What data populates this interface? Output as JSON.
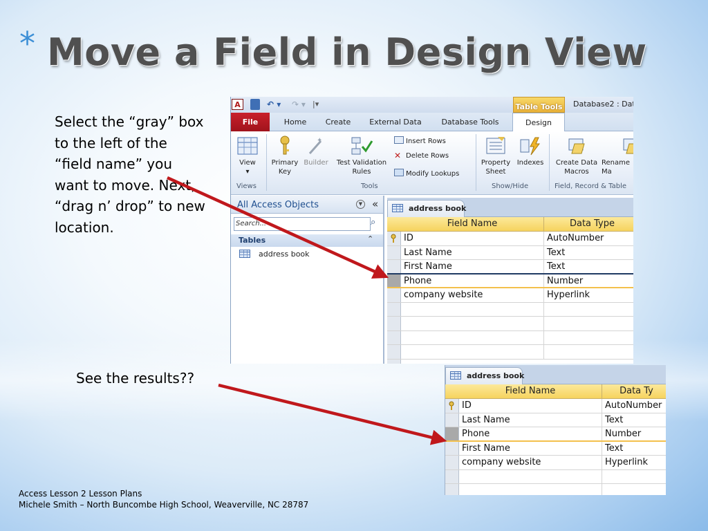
{
  "slide": {
    "title_bullet": "*",
    "title": "Move a Field in Design View",
    "instructions": "Select the “gray” box to the left of the “field name” you want to move.  Next, “drag n’ drop” to new location.",
    "results_caption": "See the results??",
    "footer_line1": "Access Lesson 2 Lesson Plans",
    "footer_line2": "Michele Smith – North Buncombe High School, Weaverville, NC  28787",
    "arrow_color": "#c0181c"
  },
  "access": {
    "app_icon": "A",
    "context_tab": "Table Tools",
    "window_title": "Database2 : Dat",
    "tabs": [
      "File",
      "Home",
      "Create",
      "External Data",
      "Database Tools",
      "Design"
    ],
    "ribbon": {
      "view": "View",
      "primary_key": "Primary Key",
      "builder": "Builder",
      "test_validation": "Test Validation Rules",
      "insert_rows": "Insert Rows",
      "delete_rows": "Delete Rows",
      "modify_lookups": "Modify Lookups",
      "property_sheet": "Property Sheet",
      "indexes": "Indexes",
      "create_data_macros": "Create Data Macros",
      "rename": "Rename Ma",
      "group_views": "Views",
      "group_tools": "Tools",
      "group_showhide": "Show/Hide",
      "group_field": "Field, Record & Table"
    },
    "nav": {
      "title": "All Access Objects",
      "search_placeholder": "Search...",
      "group": "Tables",
      "item": "address book"
    }
  },
  "designer_before": {
    "tab": "address book",
    "col_field": "Field Name",
    "col_type": "Data Type",
    "rows": [
      {
        "field": "ID",
        "type": "AutoNumber"
      },
      {
        "field": "Last Name",
        "type": "Text"
      },
      {
        "field": "First Name",
        "type": "Text"
      },
      {
        "field": "Phone",
        "type": "Number"
      },
      {
        "field": "company website",
        "type": "Hyperlink"
      }
    ]
  },
  "designer_after": {
    "tab": "address book",
    "col_field": "Field Name",
    "col_type": "Data Ty",
    "rows": [
      {
        "field": "ID",
        "type": "AutoNumber"
      },
      {
        "field": "Last Name",
        "type": "Text"
      },
      {
        "field": "Phone",
        "type": "Number"
      },
      {
        "field": "First Name",
        "type": "Text"
      },
      {
        "field": "company website",
        "type": "Hyperlink"
      }
    ]
  }
}
